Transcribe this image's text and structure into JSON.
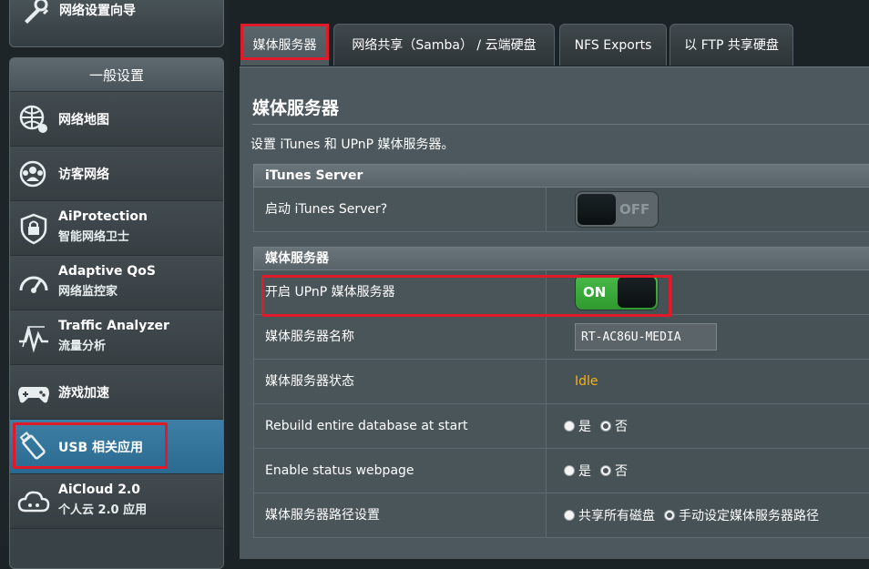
{
  "sidebar": {
    "qis_label": "网络设置向导",
    "section_title": "一般设置",
    "items": [
      {
        "name": "network-map",
        "line1": "网络地图",
        "line2": ""
      },
      {
        "name": "guest-network",
        "line1": "访客网络",
        "line2": ""
      },
      {
        "name": "aiprotection",
        "line1": "AiProtection",
        "line2": "智能网络卫士"
      },
      {
        "name": "adaptive-qos",
        "line1": "Adaptive QoS",
        "line2": "网络监控家"
      },
      {
        "name": "traffic-analyzer",
        "line1": "Traffic Analyzer",
        "line2": "流量分析"
      },
      {
        "name": "game-boost",
        "line1": "游戏加速",
        "line2": ""
      },
      {
        "name": "usb-application",
        "line1": "USB 相关应用",
        "line2": ""
      },
      {
        "name": "aicloud",
        "line1": "AiCloud 2.0",
        "line2": "个人云 2.0 应用"
      }
    ]
  },
  "tabs": [
    "媒体服务器",
    "网络共享（Samba） / 云端硬盘",
    "NFS Exports",
    "以 FTP 共享硬盘"
  ],
  "page": {
    "title": "媒体服务器",
    "description": "设置 iTunes 和 UPnP 媒体服务器。"
  },
  "itunes": {
    "header": "iTunes Server",
    "enable_label": "启动 iTunes Server?",
    "toggle_text": "OFF"
  },
  "media": {
    "header": "媒体服务器",
    "upnp_label": "开启 UPnP 媒体服务器",
    "upnp_toggle_text": "ON",
    "name_label": "媒体服务器名称",
    "name_value": "RT-AC86U-MEDIA",
    "status_label": "媒体服务器状态",
    "status_value": "Idle",
    "rebuild_label": "Rebuild entire database at start",
    "status_page_label": "Enable status webpage",
    "path_label": "媒体服务器路径设置",
    "yes": "是",
    "no": "否",
    "path_all": "共享所有磁盘",
    "path_manual": "手动设定媒体服务器路径"
  },
  "colors": {
    "accent_red": "#e11a2a",
    "active_blue": "#2b6a90",
    "toggle_on": "#3aa93a",
    "status_idle": "#f7b119"
  }
}
